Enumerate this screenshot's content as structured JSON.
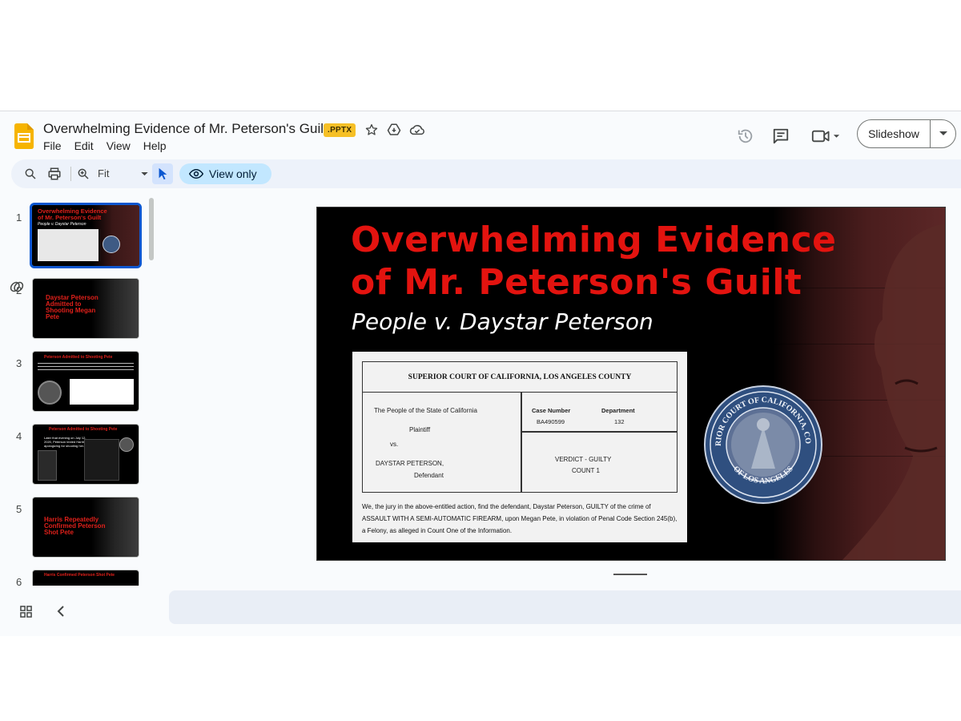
{
  "document": {
    "title": "Overwhelming Evidence of Mr. Peterson's Guilt",
    "format_badge": ".PPTX"
  },
  "menu": [
    "File",
    "Edit",
    "View",
    "Help"
  ],
  "header": {
    "slideshow_label": "Slideshow"
  },
  "toolbar": {
    "zoom_value": "Fit",
    "view_only_label": "View only"
  },
  "filmstrip": {
    "slides": [
      {
        "number": "1",
        "title_red": "Overwhelming Evidence of Mr. Peterson's Guilt",
        "subtitle": "People v. Daystar Peterson",
        "selected": true
      },
      {
        "number": "2",
        "title_red": "Daystar Peterson Admitted to Shooting Megan Pete"
      },
      {
        "number": "3",
        "title_red": "Peterson Admitted to Shooting Pete"
      },
      {
        "number": "4",
        "title_red": "Peterson Admitted to Shooting Pete",
        "body": "Later that evening on July 12, 2020, Peterson texted Harris, apologizing for shooting her."
      },
      {
        "number": "5",
        "title_red": "Harris Repeatedly Confirmed Peterson Shot Pete"
      },
      {
        "number": "6",
        "title_red": "Harris Confirmed Peterson Shot Pete"
      }
    ]
  },
  "slide": {
    "title_line1": "Overwhelming Evidence",
    "title_line2": "of Mr. Peterson's Guilt",
    "subtitle": "People v. Daystar Peterson",
    "verdict": {
      "court": "SUPERIOR COURT OF CALIFORNIA, LOS ANGELES COUNTY",
      "plaintiff_name": "The People of the State of California",
      "plaintiff_label": "Plaintiff",
      "vs": "vs.",
      "defendant_name": "DAYSTAR PETERSON,",
      "defendant_label": "Defendant",
      "case_number_label": "Case Number",
      "case_number": "BA490599",
      "department_label": "Department",
      "department": "132",
      "verdict_line": "VERDICT - GUILTY",
      "count_line": "COUNT 1",
      "paragraph": "We, the jury in the above-entitled action, find the defendant, Daystar Peterson, GUILTY of the crime of ASSAULT WITH A SEMI-AUTOMATIC FIREARM, upon Megan Pete, in violation of Penal Code Section 245(b), a Felony, as alleged in Count One of the Information."
    },
    "seal_text_top": "SUPERIOR COURT OF CALIFORNIA, COUNTY",
    "seal_text_bottom": "OF LOS ANGELES"
  },
  "colors": {
    "accent_blue": "#0b57d0",
    "title_red": "#e3130f",
    "badge_yellow": "#f6c026"
  },
  "icons": [
    "slides-logo-icon",
    "star-icon",
    "move-to-drive-icon",
    "cloud-saved-icon",
    "version-history-icon",
    "comments-icon",
    "meet-icon",
    "search-icon",
    "print-icon",
    "zoom-icon",
    "pointer-icon",
    "eye-icon",
    "grid-view-icon",
    "collapse-icon",
    "linked-object-icon"
  ]
}
